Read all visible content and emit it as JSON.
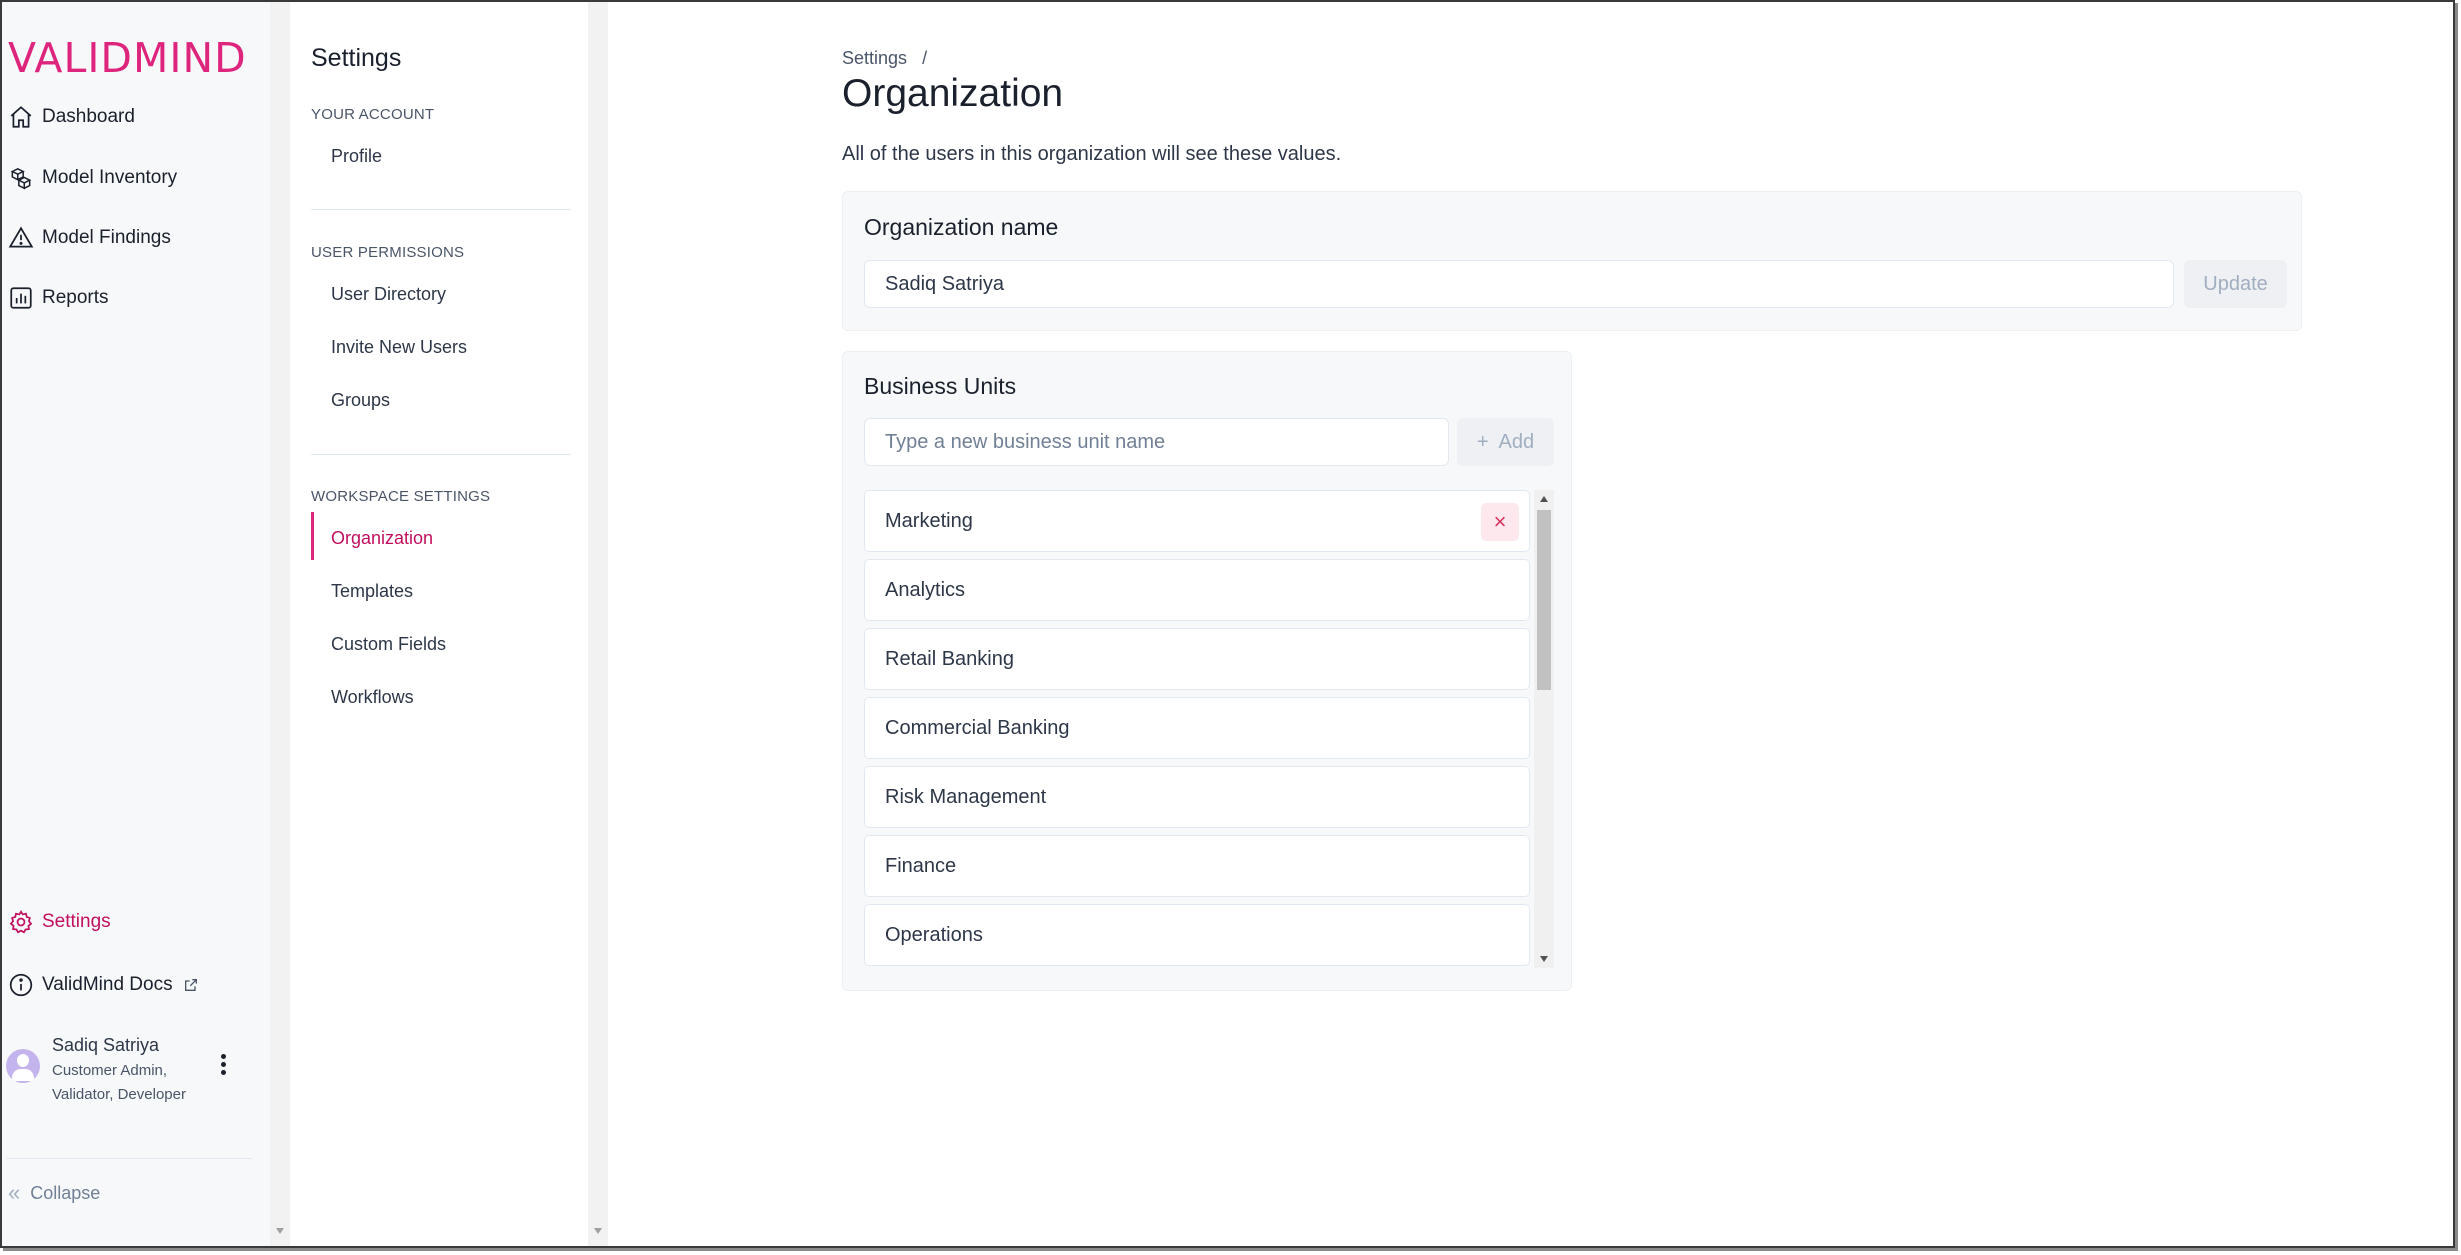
{
  "brand": {
    "logo_text": "VALIDMIND",
    "accent": "#de257e"
  },
  "leftnav": {
    "items": [
      {
        "label": "Dashboard",
        "icon": "home-icon"
      },
      {
        "label": "Model Inventory",
        "icon": "cubes-icon"
      },
      {
        "label": "Model Findings",
        "icon": "warning-icon"
      },
      {
        "label": "Reports",
        "icon": "bar-chart-icon"
      }
    ],
    "settings_label": "Settings",
    "docs_label": "ValidMind Docs",
    "user": {
      "name": "Sadiq Satriya",
      "role_line1": "Customer Admin,",
      "role_line2": "Validator, Developer"
    },
    "collapse_label": "Collapse"
  },
  "subnav": {
    "title": "Settings",
    "sections": [
      {
        "heading": "YOUR ACCOUNT",
        "items": [
          "Profile"
        ]
      },
      {
        "heading": "USER PERMISSIONS",
        "items": [
          "User Directory",
          "Invite New Users",
          "Groups"
        ]
      },
      {
        "heading": "WORKSPACE SETTINGS",
        "items": [
          "Organization",
          "Templates",
          "Custom Fields",
          "Workflows"
        ]
      }
    ],
    "active_item": "Organization"
  },
  "main": {
    "breadcrumb": {
      "parent": "Settings",
      "separator": "/"
    },
    "title": "Organization",
    "description": "All of the users in this organization will see these values.",
    "org_name_card": {
      "title": "Organization name",
      "input_value": "Sadiq Satriya",
      "update_label": "Update"
    },
    "business_units_card": {
      "title": "Business Units",
      "input_placeholder": "Type a new business unit name",
      "add_label": "Add",
      "units": [
        "Marketing",
        "Analytics",
        "Retail Banking",
        "Commercial Banking",
        "Risk Management",
        "Finance",
        "Operations"
      ]
    }
  }
}
